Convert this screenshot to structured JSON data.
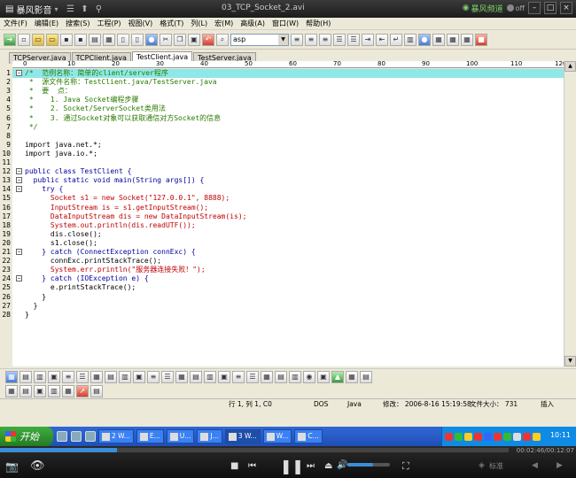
{
  "player": {
    "title": "暴风影音",
    "filename": "03_TCP_Socket_2.avi",
    "channel": "暴风频道",
    "toggle": "off",
    "time_display": "00:02:46/00:12:07",
    "quality_label": "标准",
    "progress": 0.23,
    "volume": 0.6
  },
  "editor": {
    "menu": [
      "文件(F)",
      "编辑(E)",
      "搜索(S)",
      "工程(P)",
      "视图(V)",
      "格式(T)",
      "列(L)",
      "宏(M)",
      "高级(A)",
      "窗口(W)",
      "帮助(H)"
    ],
    "syntax_combo": "asp",
    "tabs": [
      {
        "label": "TCPServer.java",
        "active": false
      },
      {
        "label": "TCPClient.java",
        "active": false
      },
      {
        "label": "TestClient.java",
        "active": true
      },
      {
        "label": "TestServer.java",
        "active": false
      }
    ],
    "ruler_labels": [
      "0",
      "10",
      "20",
      "30",
      "40",
      "50",
      "60",
      "70",
      "80",
      "90",
      "100",
      "110",
      "120"
    ],
    "code_lines": [
      {
        "n": "1",
        "text": "/*  范例名称：简单的client/server程序",
        "style": "cm",
        "fold": "-",
        "hl": true
      },
      {
        "n": "2",
        "text": " *  源文件名称：TestClient.java/TestServer.java",
        "style": "cm"
      },
      {
        "n": "3",
        "text": " *  要  点：",
        "style": "cm"
      },
      {
        "n": "4",
        "text": " *    1. Java Socket编程步骤",
        "style": "cm"
      },
      {
        "n": "5",
        "text": " *    2. Socket/ServerSocket类用法",
        "style": "cm"
      },
      {
        "n": "6",
        "text": " *    3. 通过Socket对象可以获取通信对方Socket的信息",
        "style": "cm"
      },
      {
        "n": "7",
        "text": " */",
        "style": "cm"
      },
      {
        "n": "8",
        "text": "",
        "style": "pl"
      },
      {
        "n": "9",
        "text": "import java.net.*;",
        "style": "pl"
      },
      {
        "n": "10",
        "text": "import java.io.*;",
        "style": "pl"
      },
      {
        "n": "11",
        "text": "",
        "style": "pl"
      },
      {
        "n": "12",
        "text": "public class TestClient {",
        "style": "kw",
        "fold": "-"
      },
      {
        "n": "13",
        "text": "  public static void main(String args[]) {",
        "style": "kw",
        "fold": "-"
      },
      {
        "n": "14",
        "text": "    try {",
        "style": "kw",
        "fold": "-"
      },
      {
        "n": "15",
        "text": "      Socket s1 = new Socket(\"127.0.0.1\", 8888);",
        "style": "cls"
      },
      {
        "n": "16",
        "text": "      InputStream is = s1.getInputStream();",
        "style": "cls"
      },
      {
        "n": "17",
        "text": "      DataInputStream dis = new DataInputStream(is);",
        "style": "cls"
      },
      {
        "n": "18",
        "text": "      System.out.println(dis.readUTF());",
        "style": "cls"
      },
      {
        "n": "19",
        "text": "      dis.close();",
        "style": "pl"
      },
      {
        "n": "20",
        "text": "      s1.close();",
        "style": "pl"
      },
      {
        "n": "21",
        "text": "    } catch (ConnectException connExc) {",
        "style": "kw",
        "fold": "-"
      },
      {
        "n": "22",
        "text": "      connExc.printStackTrace();",
        "style": "pl"
      },
      {
        "n": "23",
        "text": "      System.err.println(\"服务器连接失败！\");",
        "style": "cls"
      },
      {
        "n": "24",
        "text": "    } catch (IOException e) {",
        "style": "kw",
        "fold": "-"
      },
      {
        "n": "25",
        "text": "      e.printStackTrace();",
        "style": "pl"
      },
      {
        "n": "26",
        "text": "    }",
        "style": "pl"
      },
      {
        "n": "27",
        "text": "  }",
        "style": "pl"
      },
      {
        "n": "28",
        "text": "}",
        "style": "pl"
      }
    ],
    "status": {
      "position": "行 1, 列 1, C0",
      "encoding": "DOS",
      "language": "Java",
      "modified": "修改： 2006-8-16 15:19:58",
      "filesize": "文件大小： 731",
      "mode": "插入"
    }
  },
  "taskbar": {
    "start_label": "开始",
    "tasks": [
      {
        "label": "2 W...",
        "active": false
      },
      {
        "label": "E...",
        "active": false
      },
      {
        "label": "U...",
        "active": false
      },
      {
        "label": "J...",
        "active": false
      },
      {
        "label": "3 W...",
        "active": true
      },
      {
        "label": "W...",
        "active": false
      },
      {
        "label": "C...",
        "active": false
      }
    ],
    "clock": "10:11"
  }
}
